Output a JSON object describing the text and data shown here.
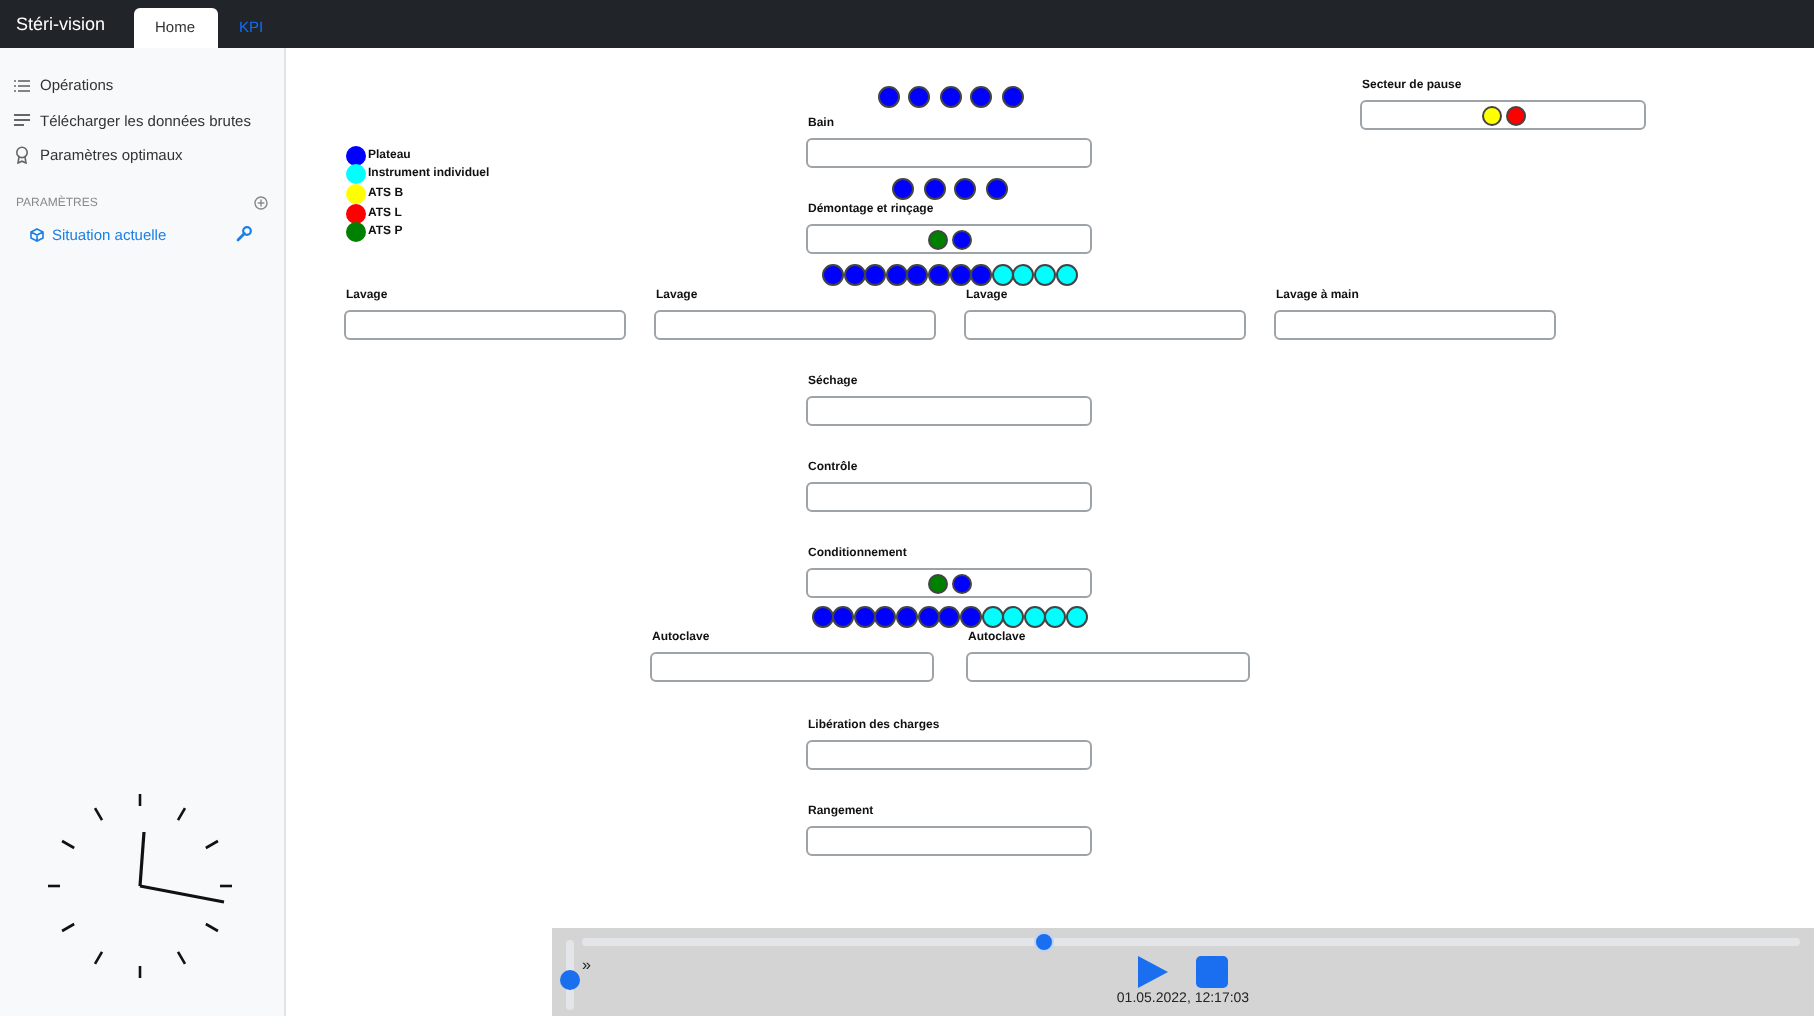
{
  "app": {
    "title": "Stéri-vision"
  },
  "tabs": [
    {
      "label": "Home",
      "selected": true
    },
    {
      "label": "KPI",
      "selected": false
    }
  ],
  "sidebar": {
    "items": [
      {
        "label": "Opérations",
        "kind": "list"
      },
      {
        "label": "Télécharger les données brutes",
        "kind": "lines"
      },
      {
        "label": "Paramètres optimaux",
        "kind": "award"
      }
    ],
    "section_title": "PARAMÈTRES",
    "settings": [
      {
        "label": "Situation actuelle",
        "selected": true
      }
    ]
  },
  "legend": [
    {
      "label": "Plateau",
      "color": "#0000ff"
    },
    {
      "label": "Instrument individuel",
      "color": "#00ffff"
    },
    {
      "label": "ATS B",
      "color": "#ffff00"
    },
    {
      "label": "ATS L",
      "color": "#ff0000"
    },
    {
      "label": "ATS P",
      "color": "#008000"
    }
  ],
  "queues": [
    {
      "dots": [
        {
          "color": "#0000ff"
        },
        {
          "color": "#0000ff"
        },
        {
          "color": "#0000ff"
        },
        {
          "color": "#0000ff"
        },
        {
          "color": "#0000ff"
        }
      ]
    },
    {
      "dots": [
        {
          "color": "#0000ff"
        },
        {
          "color": "#0000ff"
        },
        {
          "color": "#0000ff"
        },
        {
          "color": "#0000ff"
        }
      ]
    },
    {
      "dots": [
        {
          "color": "#0000ff"
        },
        {
          "color": "#0000ff"
        },
        {
          "color": "#0000ff"
        },
        {
          "color": "#0000ff"
        },
        {
          "color": "#0000ff"
        },
        {
          "color": "#0000ff"
        },
        {
          "color": "#0000ff"
        },
        {
          "color": "#0000ff"
        },
        {
          "color": "#00ffff"
        },
        {
          "color": "#00ffff"
        },
        {
          "color": "#00ffff"
        },
        {
          "color": "#00ffff"
        }
      ]
    },
    {
      "dots": [
        {
          "color": "#0000ff"
        },
        {
          "color": "#0000ff"
        },
        {
          "color": "#0000ff"
        },
        {
          "color": "#0000ff"
        },
        {
          "color": "#0000ff"
        },
        {
          "color": "#0000ff"
        },
        {
          "color": "#0000ff"
        },
        {
          "color": "#0000ff"
        },
        {
          "color": "#00ffff"
        },
        {
          "color": "#00ffff"
        },
        {
          "color": "#00ffff"
        },
        {
          "color": "#00ffff"
        },
        {
          "color": "#00ffff"
        }
      ]
    }
  ],
  "stations": [
    {
      "label": "Secteur de pause",
      "items": [
        {
          "color": "#ffff00"
        },
        {
          "color": "#ff0000"
        }
      ]
    },
    {
      "label": "Bain"
    },
    {
      "label": "Démontage et rinçage",
      "items": [
        {
          "color": "#008000"
        },
        {
          "color": "#0000ff"
        }
      ]
    },
    {
      "label": "Lavage"
    },
    {
      "label": "Lavage"
    },
    {
      "label": "Lavage"
    },
    {
      "label": "Lavage à main"
    },
    {
      "label": "Séchage"
    },
    {
      "label": "Contrôle"
    },
    {
      "label": "Conditionnement",
      "items": [
        {
          "color": "#008000"
        },
        {
          "color": "#0000ff"
        }
      ]
    },
    {
      "label": "Autoclave"
    },
    {
      "label": "Autoclave"
    },
    {
      "label": "Libération des charges"
    },
    {
      "label": "Rangement"
    }
  ],
  "player": {
    "timeline": {
      "level": 0.38
    },
    "speed": {
      "level": 0.43
    },
    "speed_label": "»",
    "timestamp": "01.05.2022, 12:17:03"
  }
}
